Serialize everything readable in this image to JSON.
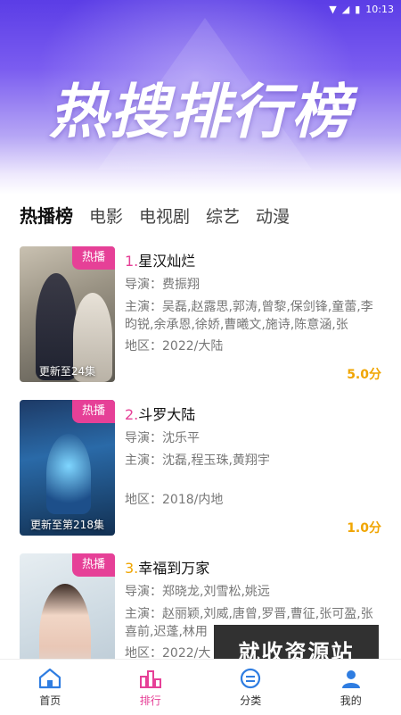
{
  "status_bar": {
    "time": "10:13"
  },
  "banner": {
    "title": "热搜排行榜"
  },
  "tabs": [
    {
      "label": "热播榜",
      "active": true
    },
    {
      "label": "电影",
      "active": false
    },
    {
      "label": "电视剧",
      "active": false
    },
    {
      "label": "综艺",
      "active": false
    },
    {
      "label": "动漫",
      "active": false
    }
  ],
  "items": [
    {
      "badge": "热播",
      "rank": "1.",
      "title": "星汉灿烂",
      "director": "导演：费振翔",
      "cast": "主演：吴磊,赵露思,郭涛,曾黎,保剑锋,童蕾,李昀锐,余承恩,徐娇,曹曦文,施诗,陈意涵,张",
      "area": "地区：2022/大陆",
      "update": "更新至24集",
      "score": "5.0分"
    },
    {
      "badge": "热播",
      "rank": "2.",
      "title": "斗罗大陆",
      "director": "导演：沈乐平",
      "cast": "主演：沈磊,程玉珠,黄翔宇",
      "area": "地区：2018/内地",
      "update": "更新至第218集",
      "score": "1.0分"
    },
    {
      "badge": "热播",
      "rank": "3.",
      "title": "幸福到万家",
      "director": "导演：郑晓龙,刘雪松,姚远",
      "cast": "主演：赵丽颖,刘威,唐曾,罗晋,曹征,张可盈,张喜前,迟蓬,林用",
      "area": "地区：2022/大",
      "update": "",
      "score": ""
    }
  ],
  "watermark": "就收资源站",
  "bottom_nav": [
    {
      "label": "首页",
      "icon": "home-icon",
      "active": false
    },
    {
      "label": "排行",
      "icon": "ranking-icon",
      "active": true
    },
    {
      "label": "分类",
      "icon": "category-icon",
      "active": false
    },
    {
      "label": "我的",
      "icon": "profile-icon",
      "active": false
    }
  ],
  "colors": {
    "accent": "#e64097",
    "score": "#f0a500",
    "nav_blue": "#2f7de1"
  }
}
